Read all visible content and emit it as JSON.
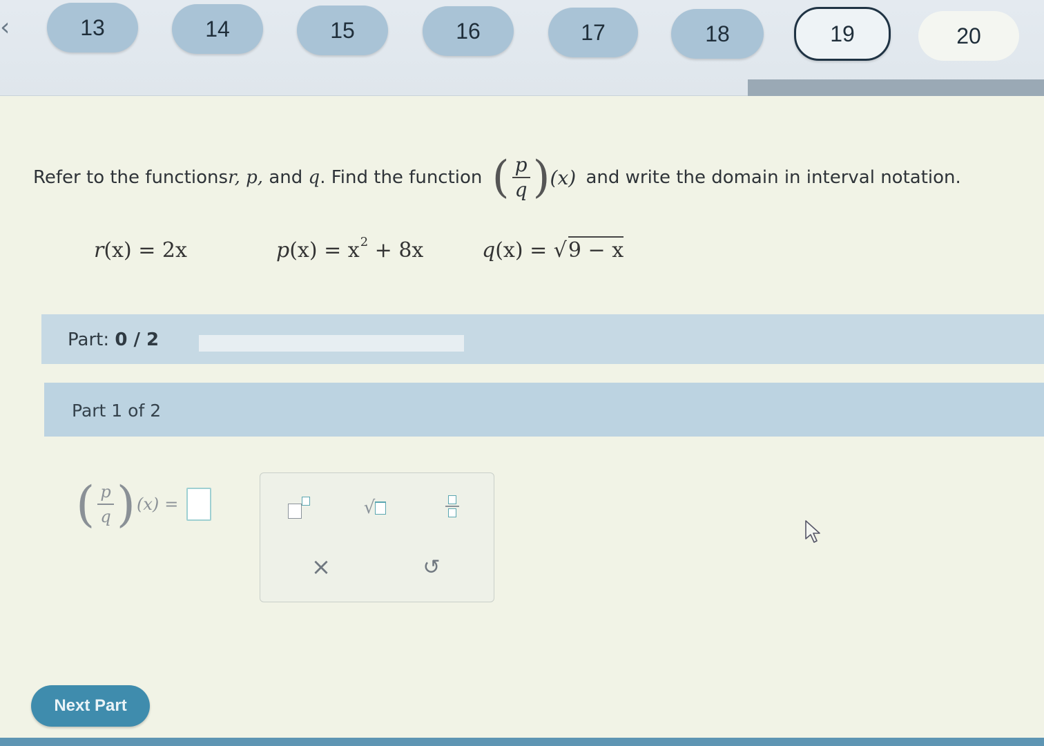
{
  "nav": {
    "questions": [
      {
        "label": "13",
        "state": "visited"
      },
      {
        "label": "14",
        "state": "visited"
      },
      {
        "label": "15",
        "state": "visited"
      },
      {
        "label": "16",
        "state": "visited"
      },
      {
        "label": "17",
        "state": "visited"
      },
      {
        "label": "18",
        "state": "visited"
      },
      {
        "label": "19",
        "state": "current"
      },
      {
        "label": "20",
        "state": "unvisited"
      }
    ]
  },
  "question": {
    "text_before": "Refer to the functions ",
    "vars": "r, p,",
    "text_and": " and ",
    "var_q": "q",
    "text_find": ". Find the function ",
    "frac_num": "p",
    "frac_den": "q",
    "arg": "(x)",
    "text_after": " and write the domain in interval notation."
  },
  "functions": {
    "r": {
      "name": "r",
      "arg": "(x)",
      "rhs": "= 2x"
    },
    "p": {
      "name": "p",
      "arg": "(x)",
      "rhs_a": "= x",
      "exp": "2",
      "rhs_b": " + 8x"
    },
    "q": {
      "name": "q",
      "arg": "(x)",
      "rhs_a": "= ",
      "radicand": "9 − x"
    }
  },
  "progress": {
    "label": "Part: ",
    "value": "0 / 2"
  },
  "part": {
    "label": "Part 1 of 2"
  },
  "answer": {
    "frac_num": "p",
    "frac_den": "q",
    "arg": "(x)",
    "eq": "="
  },
  "toolpad": {
    "clear_glyph": "×",
    "undo_glyph": "↺"
  },
  "next_button": {
    "label": "Next Part"
  },
  "colors": {
    "accent": "#3f8cad",
    "nav_bubble": "#a9c3d6",
    "part_bar": "#c6d9e4"
  }
}
